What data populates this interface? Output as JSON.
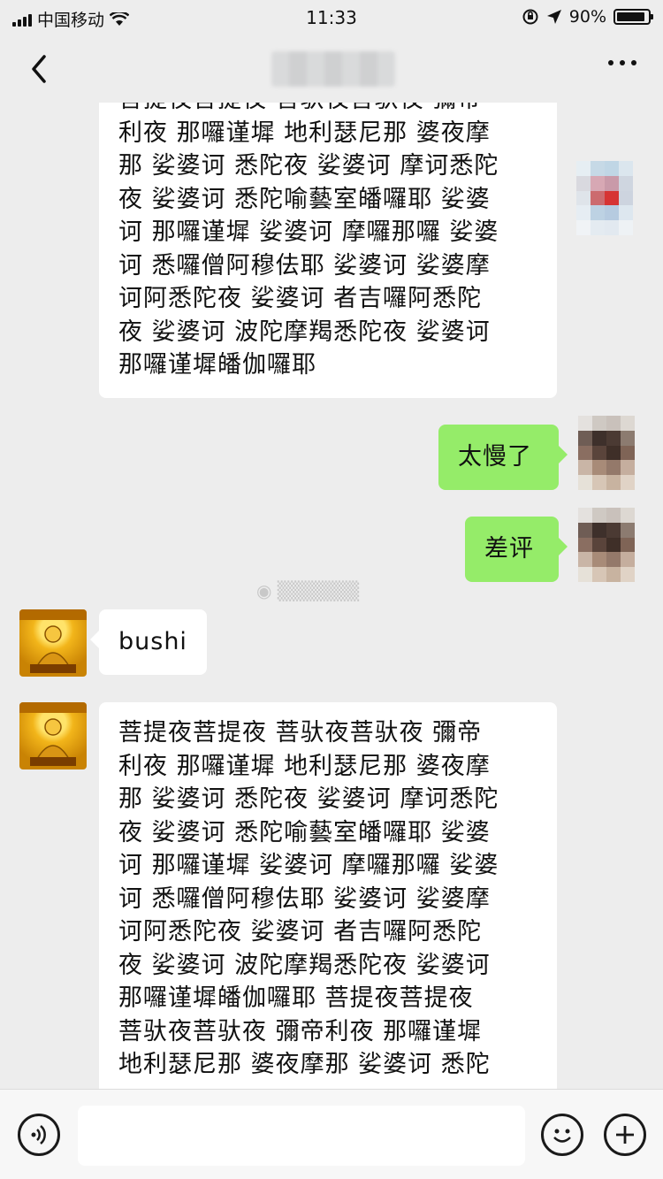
{
  "status_bar": {
    "carrier": "中国移动",
    "time": "11:33",
    "battery_percent": "90%",
    "battery_level": 0.9,
    "icons": [
      "signal-icon",
      "wifi-icon",
      "screen-rotation-lock-icon",
      "location-arrow-icon",
      "battery-icon"
    ]
  },
  "nav": {
    "back_icon": "chevron-left-icon",
    "more_icon": "more-dots-icon"
  },
  "messages": [
    {
      "sender": "other",
      "type": "text",
      "text": "菩提夜菩提夜 菩驮夜菩驮夜 彌帝\n利夜 那囉谨墀 地利瑟尼那 婆夜摩\n那 娑婆诃 悉陀夜 娑婆诃 摩诃悉陀\n夜 娑婆诃 悉陀喻藝室皤囉耶 娑婆\n诃 那囉谨墀 娑婆诃 摩囉那囉 娑婆\n诃 悉囉僧阿穆佉耶 娑婆诃 娑婆摩\n诃阿悉陀夜 娑婆诃 者吉囉阿悉陀\n夜 娑婆诃 波陀摩羯悉陀夜 娑婆诃\n那囉谨墀皤伽囉耶"
    },
    {
      "sender": "me",
      "type": "text",
      "text": "太慢了"
    },
    {
      "sender": "me",
      "type": "text",
      "text": "差评"
    },
    {
      "sender": "other",
      "type": "text",
      "text": "bushi"
    },
    {
      "sender": "other",
      "type": "text",
      "text": "菩提夜菩提夜 菩驮夜菩驮夜 彌帝\n利夜 那囉谨墀 地利瑟尼那 婆夜摩\n那 娑婆诃 悉陀夜 娑婆诃 摩诃悉陀\n夜 娑婆诃 悉陀喻藝室皤囉耶 娑婆\n诃 那囉谨墀 娑婆诃 摩囉那囉 娑婆\n诃 悉囉僧阿穆佉耶 娑婆诃 娑婆摩\n诃阿悉陀夜 娑婆诃 者吉囉阿悉陀\n夜 娑婆诃 波陀摩羯悉陀夜 娑婆诃\n那囉谨墀皤伽囉耶 菩提夜菩提夜\n菩驮夜菩驮夜 彌帝利夜 那囉谨墀\n地利瑟尼那 婆夜摩那 娑婆诃 悉陀"
    }
  ],
  "input_bar": {
    "voice_icon": "voice-icon",
    "emoji_icon": "emoji-icon",
    "plus_icon": "plus-icon",
    "input_value": ""
  },
  "colors": {
    "chat_background": "#ededed",
    "my_bubble": "#95ec69",
    "other_bubble": "#ffffff"
  }
}
